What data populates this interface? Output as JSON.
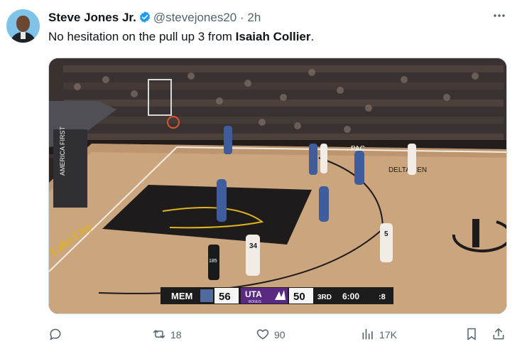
{
  "author": {
    "name": "Steve Jones Jr.",
    "handle": "@stevejones20",
    "separator": "·",
    "time": "2h"
  },
  "tweet": {
    "text_before": "No hesitation on the pull up 3 from ",
    "text_bold": "Isaiah Collier",
    "text_after": "."
  },
  "media": {
    "scorebug": {
      "away_team": "MEM",
      "away_score": "56",
      "home_team": "UTA",
      "home_bonus": "BONUS",
      "home_score": "50",
      "period": "3RD",
      "clock": "6:00",
      "shot_clock": ":8"
    },
    "jerseys": [
      "34",
      "5",
      "185"
    ],
    "court_sponsors": [
      "AMERICA FIRST",
      "DELTA CEN",
      "PAC",
      "Lake City"
    ],
    "colors": {
      "home_purple": "#5a2a82",
      "away_navy": "#1d2a55"
    }
  },
  "actions": {
    "replies": "",
    "retweets": "18",
    "likes": "90",
    "views": "17K"
  },
  "icons": [
    "verified-badge-icon",
    "more-icon",
    "reply-icon",
    "retweet-icon",
    "like-icon",
    "views-icon",
    "bookmark-icon",
    "share-icon"
  ]
}
